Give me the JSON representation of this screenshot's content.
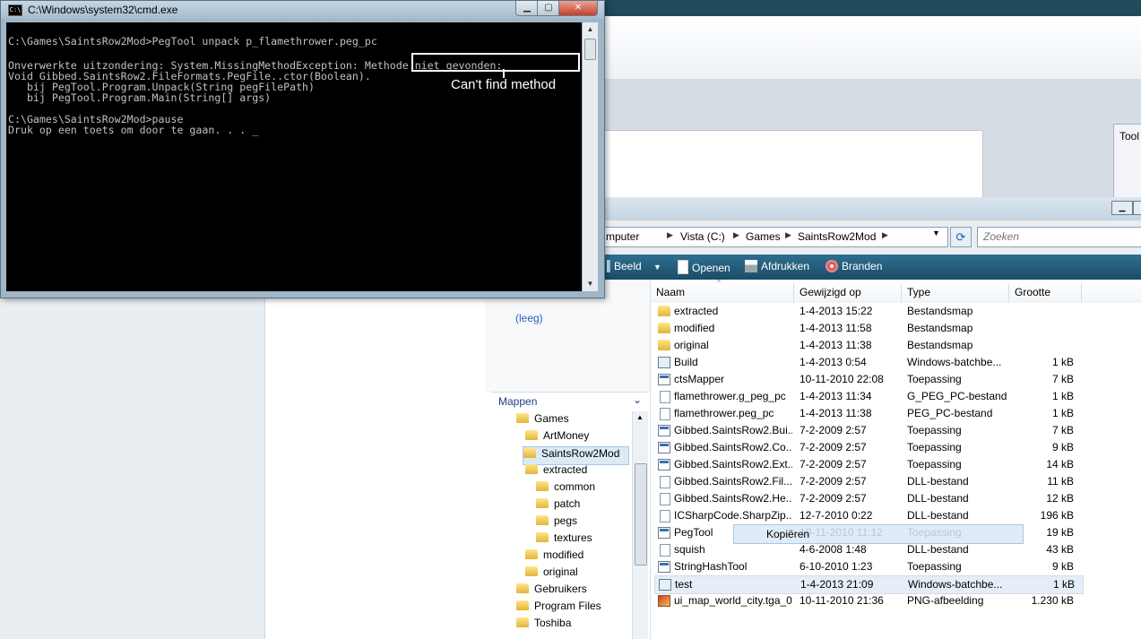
{
  "cmd": {
    "title": "C:\\Windows\\system32\\cmd.exe",
    "icon_text": "C:\\",
    "lines": [
      "C:\\Games\\SaintsRow2Mod>PegTool unpack p_flamethrower.peg_pc",
      "",
      "Onverwerkte uitzondering: System.MissingMethodException: Methode niet gevonden:",
      "Void Gibbed.SaintsRow2.FileFormats.PegFile..ctor(Boolean).",
      "   bij PegTool.Program.Unpack(String pegFilePath)",
      "   bij PegTool.Program.Main(String[] args)",
      "",
      "C:\\Games\\SaintsRow2Mod>pause",
      "Druk op een toets om door te gaan. . . _"
    ],
    "annotation": "Can't find method"
  },
  "background": {
    "tool_panel_label": "Tool"
  },
  "explorer": {
    "breadcrumb": [
      "mputer",
      "Vista (C:)",
      "Games",
      "SaintsRow2Mod"
    ],
    "search_placeholder": "Zoeken",
    "toolbar": [
      {
        "label": "Beeld",
        "icon": "view-icon"
      },
      {
        "label": "Openen",
        "icon": "open-icon"
      },
      {
        "label": "Afdrukken",
        "icon": "print-icon"
      },
      {
        "label": "Branden",
        "icon": "burn-icon"
      }
    ],
    "nav_empty": "(leeg)",
    "folders_header": "Mappen",
    "tree": [
      {
        "label": "Games",
        "level": 0
      },
      {
        "label": "ArtMoney",
        "level": 1
      },
      {
        "label": "SaintsRow2Mod",
        "level": 1,
        "selected": true
      },
      {
        "label": "extracted",
        "level": 2
      },
      {
        "label": "common",
        "level": 3
      },
      {
        "label": "patch",
        "level": 3
      },
      {
        "label": "pegs",
        "level": 3
      },
      {
        "label": "textures",
        "level": 3
      },
      {
        "label": "modified",
        "level": 2
      },
      {
        "label": "original",
        "level": 2
      },
      {
        "label": "Gebruikers",
        "level": 0
      },
      {
        "label": "Program Files",
        "level": 0
      },
      {
        "label": "Toshiba",
        "level": 0
      }
    ],
    "columns": [
      "Naam",
      "Gewijzigd op",
      "Type",
      "Grootte"
    ],
    "files": [
      {
        "name": "extracted",
        "date": "1-4-2013 15:22",
        "type": "Bestandsmap",
        "size": "",
        "icon": "folder"
      },
      {
        "name": "modified",
        "date": "1-4-2013 11:58",
        "type": "Bestandsmap",
        "size": "",
        "icon": "folder"
      },
      {
        "name": "original",
        "date": "1-4-2013 11:38",
        "type": "Bestandsmap",
        "size": "",
        "icon": "folder"
      },
      {
        "name": "Build",
        "date": "1-4-2013 0:54",
        "type": "Windows-batchbe...",
        "size": "1 kB",
        "icon": "bat"
      },
      {
        "name": "ctsMapper",
        "date": "10-11-2010 22:08",
        "type": "Toepassing",
        "size": "7 kB",
        "icon": "app"
      },
      {
        "name": "flamethrower.g_peg_pc",
        "date": "1-4-2013 11:34",
        "type": "G_PEG_PC-bestand",
        "size": "1 kB",
        "icon": "doc"
      },
      {
        "name": "flamethrower.peg_pc",
        "date": "1-4-2013 11:38",
        "type": "PEG_PC-bestand",
        "size": "1 kB",
        "icon": "doc"
      },
      {
        "name": "Gibbed.SaintsRow2.Bui...",
        "date": "7-2-2009 2:57",
        "type": "Toepassing",
        "size": "7 kB",
        "icon": "app"
      },
      {
        "name": "Gibbed.SaintsRow2.Co...",
        "date": "7-2-2009 2:57",
        "type": "Toepassing",
        "size": "9 kB",
        "icon": "app"
      },
      {
        "name": "Gibbed.SaintsRow2.Ext...",
        "date": "7-2-2009 2:57",
        "type": "Toepassing",
        "size": "14 kB",
        "icon": "app"
      },
      {
        "name": "Gibbed.SaintsRow2.Fil...",
        "date": "7-2-2009 2:57",
        "type": "DLL-bestand",
        "size": "11 kB",
        "icon": "doc"
      },
      {
        "name": "Gibbed.SaintsRow2.He...",
        "date": "7-2-2009 2:57",
        "type": "DLL-bestand",
        "size": "12 kB",
        "icon": "doc"
      },
      {
        "name": "ICSharpCode.SharpZip...",
        "date": "12-7-2010 0:22",
        "type": "DLL-bestand",
        "size": "196 kB",
        "icon": "doc"
      },
      {
        "name": "PegTool",
        "date": "10-11-2010 11:12",
        "type": "Toepassing",
        "size": "19 kB",
        "icon": "app"
      },
      {
        "name": "squish",
        "date": "4-6-2008 1:48",
        "type": "DLL-bestand",
        "size": "43 kB",
        "icon": "doc"
      },
      {
        "name": "StringHashTool",
        "date": "6-10-2010 1:23",
        "type": "Toepassing",
        "size": "9 kB",
        "icon": "app"
      },
      {
        "name": "test",
        "date": "1-4-2013 21:09",
        "type": "Windows-batchbe...",
        "size": "1 kB",
        "icon": "bat",
        "selected": true
      },
      {
        "name": "ui_map_world_city.tga_0",
        "date": "10-11-2010 21:36",
        "type": "PNG-afbeelding",
        "size": "1.230 kB",
        "icon": "png"
      }
    ],
    "drag_tooltip": "Kopiëren"
  }
}
